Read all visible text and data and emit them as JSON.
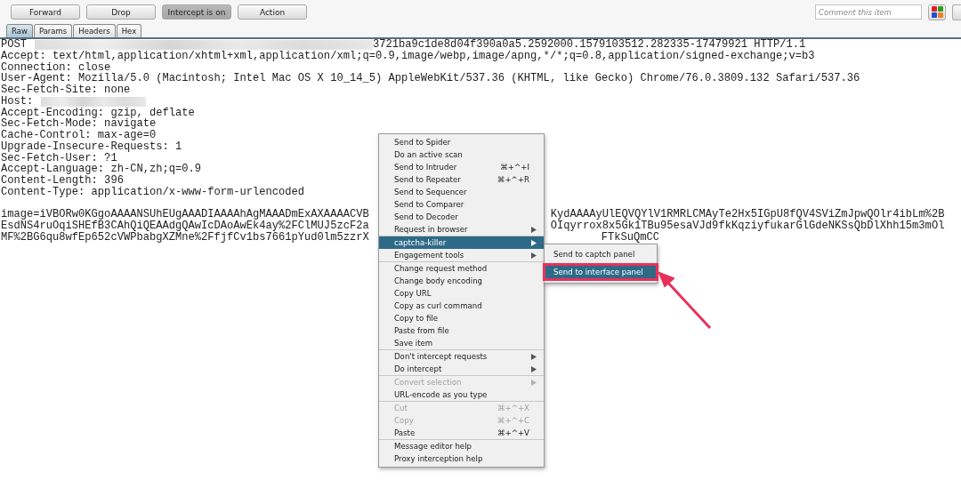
{
  "toolbar": {
    "buttons": [
      {
        "label": "Forward",
        "selected": false
      },
      {
        "label": "Drop",
        "selected": false
      },
      {
        "label": "Intercept is on",
        "selected": true
      },
      {
        "label": "Action",
        "selected": false
      }
    ],
    "comment": {
      "placeholder": "Comment this item"
    }
  },
  "tabs": [
    {
      "label": "Raw",
      "selected": true
    },
    {
      "label": "Params",
      "selected": false
    },
    {
      "label": "Headers",
      "selected": false
    },
    {
      "label": "Hex",
      "selected": false
    }
  ],
  "request": {
    "lines": [
      {
        "kind": "redacted",
        "before": "POST",
        "after": "3721ba9c1de8d04f390a0a5.2592000.1579103512.282335-17479921 HTTP/1.1"
      },
      {
        "kind": "text",
        "text": "Accept: text/html,application/xhtml+xml,application/xml;q=0.9,image/webp,image/apng,*/*;q=0.8,application/signed-exchange;v=b3"
      },
      {
        "kind": "text",
        "text": "Connection: close"
      },
      {
        "kind": "text",
        "text": "User-Agent: Mozilla/5.0 (Macintosh; Intel Mac OS X 10_14_5) AppleWebKit/537.36 (KHTML, like Gecko) Chrome/76.0.3809.132 Safari/537.36"
      },
      {
        "kind": "text",
        "text": "Sec-Fetch-Site: none"
      },
      {
        "kind": "redacted-short",
        "before": "Host:"
      },
      {
        "kind": "text",
        "text": "Accept-Encoding: gzip, deflate"
      },
      {
        "kind": "text",
        "text": "Sec-Fetch-Mode: navigate"
      },
      {
        "kind": "text",
        "text": "Cache-Control: max-age=0"
      },
      {
        "kind": "text",
        "text": "Upgrade-Insecure-Requests: 1"
      },
      {
        "kind": "text",
        "text": "Sec-Fetch-User: ?1"
      },
      {
        "kind": "text",
        "text": "Accept-Language: zh-CN,zh;q=0.9"
      },
      {
        "kind": "text",
        "text": "Content-Length: 396"
      },
      {
        "kind": "text",
        "text": "Content-Type: application/x-www-form-urlencoded"
      },
      {
        "kind": "blank"
      },
      {
        "kind": "split",
        "left": "image=iVBORw0KGgoAAAANSUhEUgAAADIAAAAhAgMAAADmExAXAAAACVB",
        "right": "KydAAAAyUlEQVQYlV1RMRLCMAyTe2Hx5IGpU8fQV4SViZmJpwQOlr4ibLm%2B"
      },
      {
        "kind": "split",
        "left": "EsdNS4ruOqiSHEfB3CAhQiQEAAdgQAwIcDAoAwEk4ay%2FClMUJ5zcF2a",
        "right": "OIqyrrox8x5Gk1TBu95esaVJd9fkKqziyfukarGlGdeNKSsQbDlXhh15m3mOl"
      },
      {
        "kind": "split-far",
        "left": "MF%2BG6qu8wfEp652cVWPbabgXZMne%2FfjfCv1bs7661pYud0lm5zzrX",
        "right": "FTkSuQmCC"
      }
    ]
  },
  "context_menu": {
    "groups": [
      {
        "items": [
          {
            "label": "Send to Spider",
            "submenu": false,
            "disabled": false,
            "selected": false
          },
          {
            "label": "Do an active scan",
            "submenu": false,
            "disabled": false,
            "selected": false
          },
          {
            "label": "Send to Intruder",
            "shortcut": "⌘+^+I",
            "submenu": false,
            "disabled": false,
            "selected": false
          },
          {
            "label": "Send to Repeater",
            "shortcut": "⌘+^+R",
            "submenu": false,
            "disabled": false,
            "selected": false
          },
          {
            "label": "Send to Sequencer",
            "submenu": false,
            "disabled": false,
            "selected": false
          },
          {
            "label": "Send to Comparer",
            "submenu": false,
            "disabled": false,
            "selected": false
          },
          {
            "label": "Send to Decoder",
            "submenu": false,
            "disabled": false,
            "selected": false
          },
          {
            "label": "Request in browser",
            "submenu": true,
            "disabled": false,
            "selected": false
          }
        ]
      },
      {
        "items": [
          {
            "label": "captcha-killer",
            "submenu": true,
            "disabled": false,
            "selected": true
          },
          {
            "label": "Engagement tools",
            "submenu": true,
            "disabled": false,
            "selected": false
          }
        ]
      },
      {
        "items": [
          {
            "label": "Change request method",
            "submenu": false,
            "disabled": false,
            "selected": false
          },
          {
            "label": "Change body encoding",
            "submenu": false,
            "disabled": false,
            "selected": false
          },
          {
            "label": "Copy URL",
            "submenu": false,
            "disabled": false,
            "selected": false
          },
          {
            "label": "Copy as curl command",
            "submenu": false,
            "disabled": false,
            "selected": false
          },
          {
            "label": "Copy to file",
            "submenu": false,
            "disabled": false,
            "selected": false
          },
          {
            "label": "Paste from file",
            "submenu": false,
            "disabled": false,
            "selected": false
          },
          {
            "label": "Save item",
            "submenu": false,
            "disabled": false,
            "selected": false
          }
        ]
      },
      {
        "items": [
          {
            "label": "Don't intercept requests",
            "submenu": true,
            "disabled": false,
            "selected": false
          },
          {
            "label": "Do intercept",
            "submenu": true,
            "disabled": false,
            "selected": false
          }
        ]
      },
      {
        "items": [
          {
            "label": "Convert selection",
            "submenu": true,
            "disabled": true,
            "selected": false
          },
          {
            "label": "URL-encode as you type",
            "submenu": false,
            "disabled": false,
            "selected": false
          }
        ]
      },
      {
        "items": [
          {
            "label": "Cut",
            "shortcut": "⌘+^+X",
            "submenu": false,
            "disabled": true,
            "selected": false
          },
          {
            "label": "Copy",
            "shortcut": "⌘+^+C",
            "submenu": false,
            "disabled": true,
            "selected": false
          },
          {
            "label": "Paste",
            "shortcut": "⌘+^+V",
            "submenu": false,
            "disabled": false,
            "selected": false
          }
        ]
      },
      {
        "items": [
          {
            "label": "Message editor help",
            "submenu": false,
            "disabled": false,
            "selected": false
          },
          {
            "label": "Proxy interception help",
            "submenu": false,
            "disabled": false,
            "selected": false
          }
        ]
      }
    ],
    "submenu": {
      "items": [
        {
          "label": "Send to captch panel",
          "selected": false
        },
        {
          "label": "Send to interface panel",
          "selected": true
        }
      ]
    }
  }
}
